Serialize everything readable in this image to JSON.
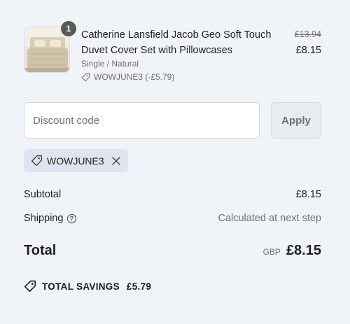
{
  "line_item": {
    "quantity": "1",
    "name": "Catherine Lansfield Jacob Geo Soft Touch Duvet Cover Set with Pillowcases",
    "variant": "Single / Natural",
    "applied_discount": "WOWJUNE3 (-£5.79)",
    "price_original": "£13.94",
    "price_final": "£8.15",
    "image_icon": "bedding-product-image"
  },
  "discount": {
    "placeholder": "Discount code",
    "apply_label": "Apply",
    "applied_code": "WOWJUNE3"
  },
  "summary": {
    "subtotal_label": "Subtotal",
    "subtotal_value": "£8.15",
    "shipping_label": "Shipping",
    "shipping_value": "Calculated at next step",
    "total_label": "Total",
    "total_currency": "GBP",
    "total_value": "£8.15",
    "savings_label": "TOTAL SAVINGS",
    "savings_value": "£5.79"
  },
  "colors": {
    "background": "#f0f3f8",
    "chip_background": "#dfe5ee",
    "badge": "#595959"
  }
}
